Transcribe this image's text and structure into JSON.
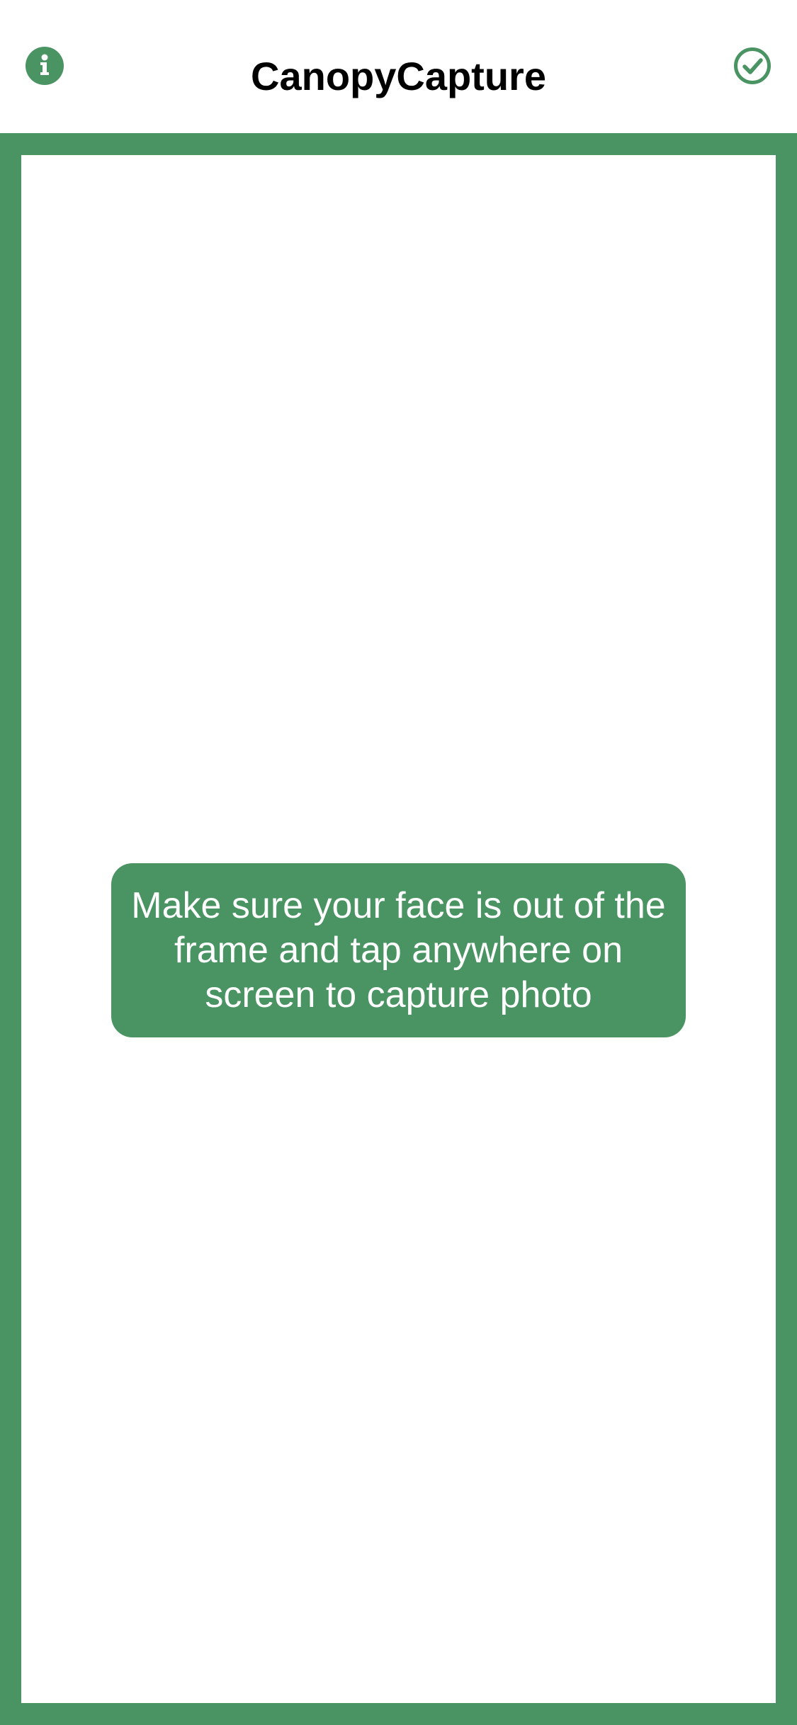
{
  "app": {
    "title": "CanopyCapture"
  },
  "header": {
    "info_icon": "info-icon",
    "done_icon": "check-circle-icon"
  },
  "viewfinder": {
    "hint": "Make sure your face is out of the frame and tap anywhere on screen to capture photo"
  },
  "colors": {
    "accent": "#4a9463",
    "background": "#ffffff",
    "title_text": "#000000",
    "hint_text": "#ffffff"
  }
}
